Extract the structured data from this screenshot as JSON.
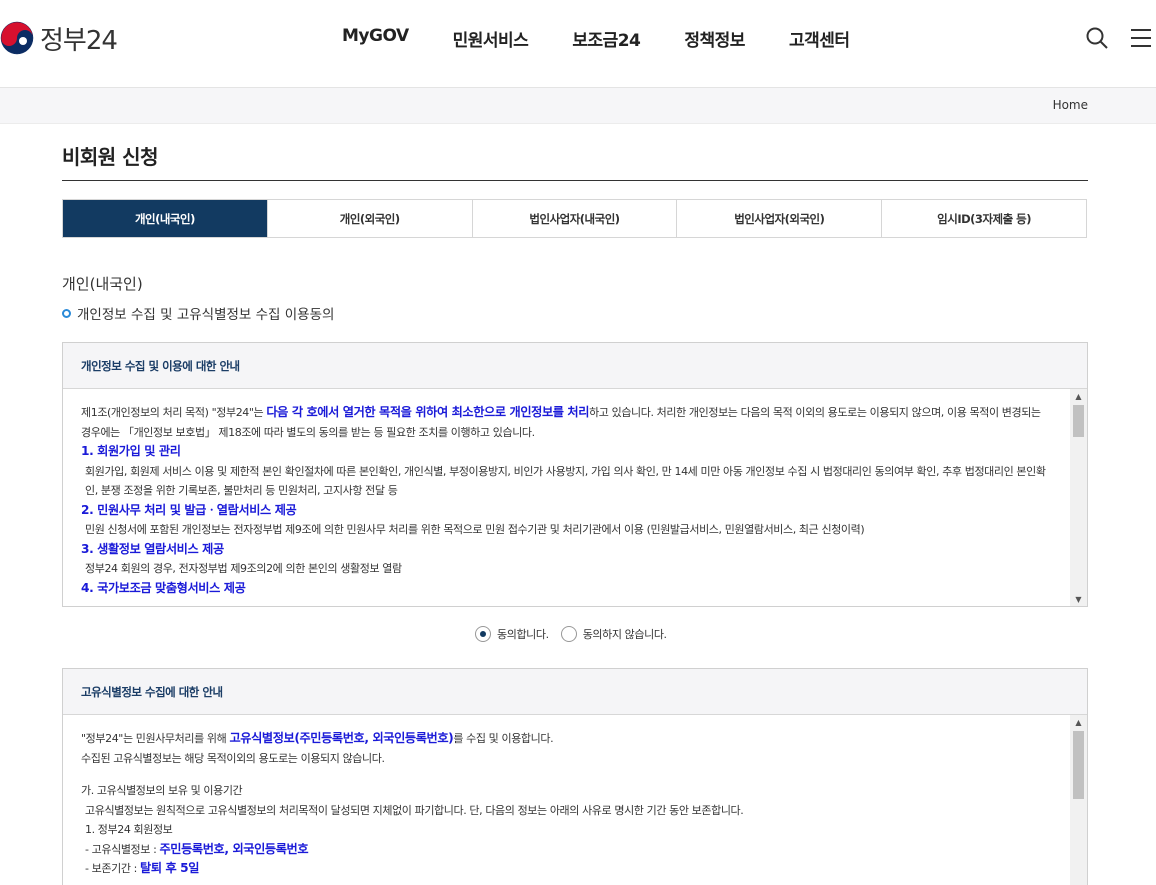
{
  "brand": {
    "name": "정부24"
  },
  "nav": [
    "MyGOV",
    "민원서비스",
    "보조금24",
    "정책정보",
    "고객센터"
  ],
  "breadcrumb": {
    "home": "Home"
  },
  "page": {
    "title": "비회원 신청"
  },
  "tabs": [
    {
      "label": "개인(내국인)",
      "active": true
    },
    {
      "label": "개인(외국인)",
      "active": false
    },
    {
      "label": "법인사업자(내국인)",
      "active": false
    },
    {
      "label": "법인사업자(외국인)",
      "active": false
    },
    {
      "label": "임시ID(3자제출 등)",
      "active": false
    }
  ],
  "section": {
    "title": "개인(내국인)",
    "subtitle": "개인정보 수집 및 고유식별정보 수집 이용동의"
  },
  "privacy": {
    "heading": "개인정보 수집 및 이용에 대한 안내",
    "intro_a": "제1조(개인정보의 처리 목적) \"정부24\"는 ",
    "intro_hl": "다음 각 호에서 열거한 목적을 위하여 최소한으로 개인정보를 처리",
    "intro_b": "하고 있습니다. 처리한 개인정보는 다음의 목적 이외의 용도로는 이용되지 않으며, 이용 목적이 변경되는 경우에는 「개인정보 보호법」 제18조에 따라 별도의 동의를 받는 등 필요한 조치를 이행하고 있습니다.",
    "item1_title": "1. 회원가입 및 관리",
    "item1_text": "회원가입, 회원제 서비스 이용 및 제한적 본인 확인절차에 따른 본인확인, 개인식별, 부정이용방지, 비인가 사용방지, 가입 의사 확인, 만 14세 미만 아동 개인정보 수집 시 법정대리인 동의여부 확인, 추후 법정대리인 본인확인, 분쟁 조정을 위한 기록보존, 불만처리 등 민원처리, 고지사항 전달 등",
    "item2_title": "2. 민원사무 처리 및 발급ㆍ열람서비스 제공",
    "item2_text": "민원 신청서에 포함된 개인정보는 전자정부법 제9조에 의한 민원사무 처리를 위한 목적으로 민원 접수기관 및 처리기관에서 이용 (민원발급서비스, 민원열람서비스, 최근 신청이력)",
    "item3_title": "3. 생활정보 열람서비스 제공",
    "item3_text": "정부24 회원의 경우, 전자정부법 제9조의2에 의한 본인의 생활정보 열람",
    "item4_title": "4. 국가보조금 맞춤형서비스 제공",
    "agree": "동의합니다.",
    "disagree": "동의하지 않습니다."
  },
  "unique_id": {
    "heading": "고유식별정보 수집에 대한 안내",
    "p1_a": "\"정부24\"는 민원사무처리를 위해 ",
    "p1_hl": "고유식별정보(주민등록번호, 외국인등록번호)",
    "p1_b": "를 수집 및 이용합니다.",
    "p2": "수집된 고유식별정보는 해당 목적이외의 용도로는 이용되지 않습니다.",
    "p3": "가. 고유식별정보의 보유 및 이용기간",
    "p4": "고유식별정보는 원칙적으로 고유식별정보의 처리목적이 달성되면 지체없이 파기합니다. 단, 다음의 정보는 아래의 사유로 명시한 기간 동안 보존합니다.",
    "p5": "1. 정부24 회원정보",
    "p6_a": "- 고유식별정보 : ",
    "p6_hl": "주민등록번호, 외국인등록번호",
    "p7_a": "- 보존기간 : ",
    "p7_hl": "탈퇴 후 5일"
  },
  "colors": {
    "active_tab": "#123a61",
    "highlight": "#1a1ad8",
    "bullet": "#2a8ad8"
  }
}
